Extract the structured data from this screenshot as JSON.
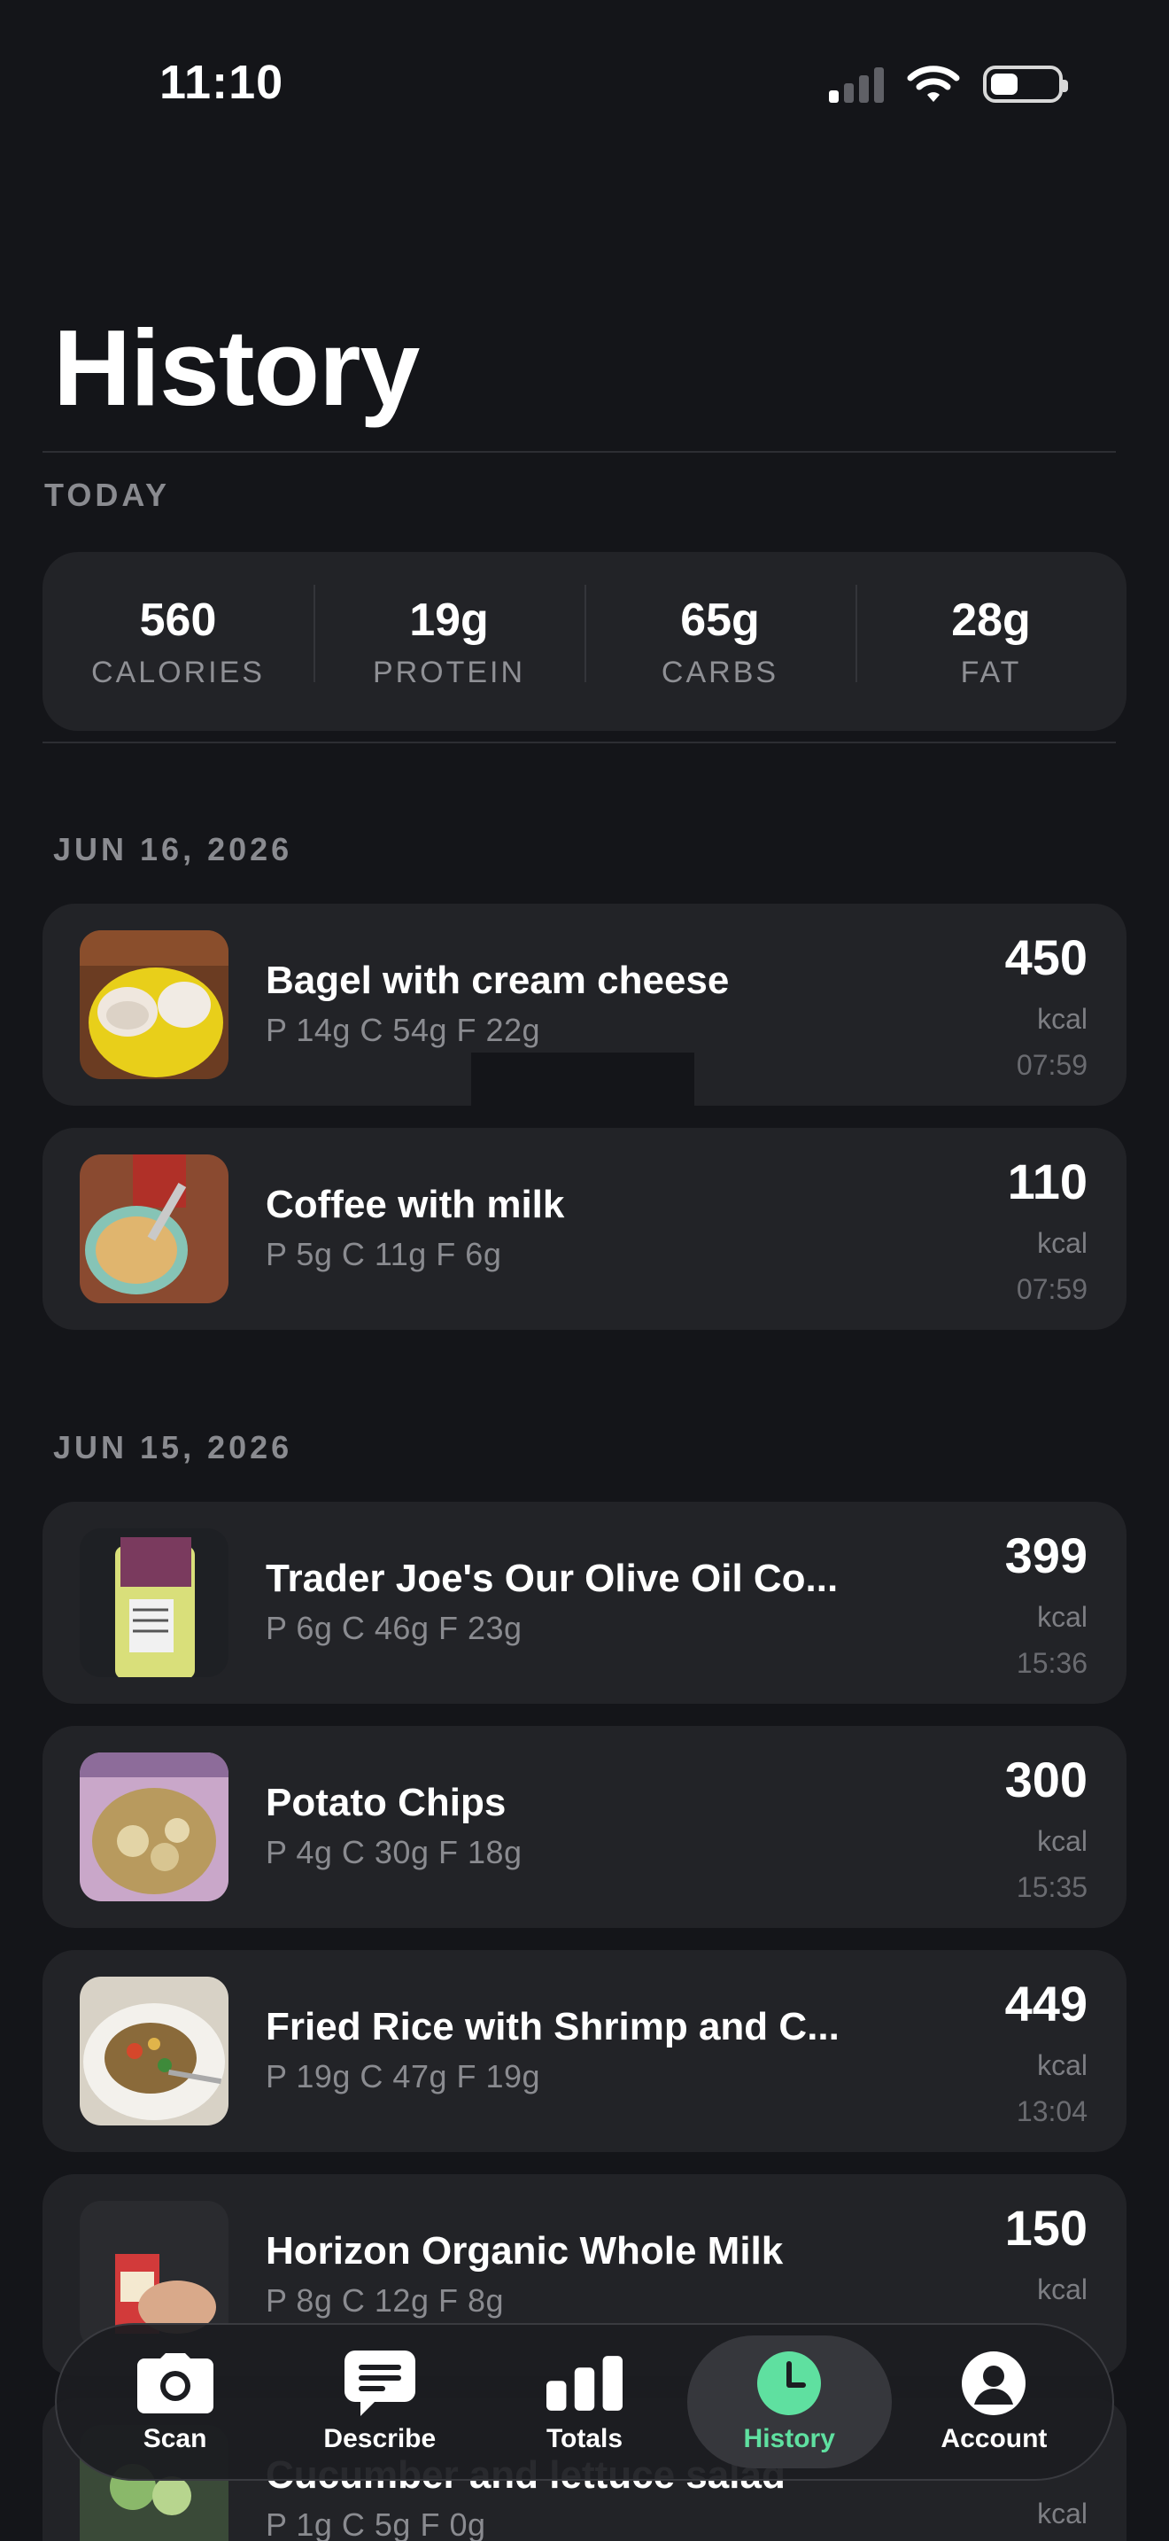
{
  "status_bar": {
    "time": "11:10"
  },
  "page": {
    "title": "History"
  },
  "today": {
    "label": "TODAY",
    "totals": [
      {
        "value": "560",
        "label": "CALORIES"
      },
      {
        "value": "19g",
        "label": "PROTEIN"
      },
      {
        "value": "65g",
        "label": "CARBS"
      },
      {
        "value": "28g",
        "label": "FAT"
      }
    ]
  },
  "days": [
    {
      "date": "JUN 16, 2026",
      "meals": [
        {
          "name": "Bagel with cream cheese",
          "macros": "P 14g  C 54g  F 22g",
          "kcal": "450",
          "unit": "kcal",
          "time": "07:59",
          "thumb": "bagel-photo"
        },
        {
          "name": "Coffee with milk",
          "macros": "P 5g  C 11g  F 6g",
          "kcal": "110",
          "unit": "kcal",
          "time": "07:59",
          "thumb": "coffee-photo"
        }
      ]
    },
    {
      "date": "JUN 15, 2026",
      "meals": [
        {
          "name": "Trader Joe's Our Olive Oil Co...",
          "macros": "P 6g  C 46g  F 23g",
          "kcal": "399",
          "unit": "kcal",
          "time": "15:36",
          "thumb": "chips-bag-photo"
        },
        {
          "name": "Potato Chips",
          "macros": "P 4g  C 30g  F 18g",
          "kcal": "300",
          "unit": "kcal",
          "time": "15:35",
          "thumb": "potato-chips-photo"
        },
        {
          "name": "Fried Rice with Shrimp and C...",
          "macros": "P 19g  C 47g  F 19g",
          "kcal": "449",
          "unit": "kcal",
          "time": "13:04",
          "thumb": "fried-rice-photo"
        },
        {
          "name": "Horizon Organic Whole Milk",
          "macros": "P 8g  C 12g  F 8g",
          "kcal": "150",
          "unit": "kcal",
          "time": "",
          "thumb": "milk-carton-photo"
        },
        {
          "name": "Cucumber and lettuce salad",
          "macros": "P 1g  C 5g  F 0g",
          "kcal": "",
          "unit": "kcal",
          "time": "",
          "thumb": "salad-photo"
        }
      ]
    }
  ],
  "tab_bar": {
    "active": "History",
    "tabs": [
      {
        "label": "Scan",
        "icon": "camera-icon"
      },
      {
        "label": "Describe",
        "icon": "chat-bubble-icon"
      },
      {
        "label": "Totals",
        "icon": "bar-chart-icon"
      },
      {
        "label": "History",
        "icon": "clock-icon"
      },
      {
        "label": "Account",
        "icon": "person-icon"
      }
    ]
  },
  "colors": {
    "background": "#141519",
    "card": "#222327",
    "accent": "#5fe0a0",
    "muted_text": "#8a8b90"
  }
}
